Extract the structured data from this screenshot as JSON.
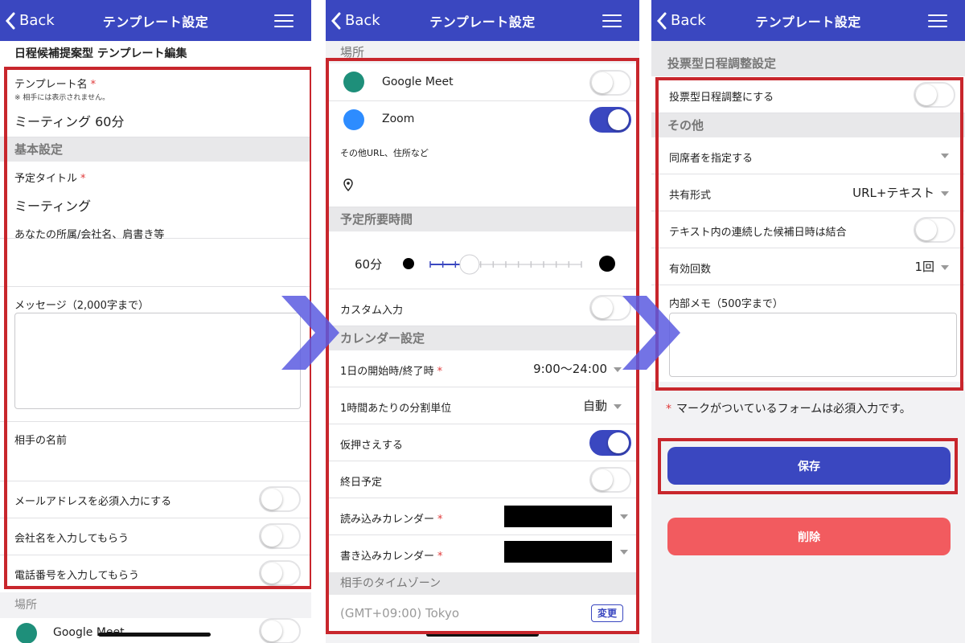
{
  "nav": {
    "back": "Back",
    "title": "テンプレート設定"
  },
  "p1": {
    "heading": "日程候補提案型 テンプレート編集",
    "template_name_label": "テンプレート名",
    "template_name_note": "※ 相手には表示されません。",
    "template_name_value": "ミーティング 60分",
    "section_basic": "基本設定",
    "title_label": "予定タイトル",
    "title_value": "ミーティング",
    "affiliation_label": "あなたの所属/会社名、肩書き等",
    "message_label": "メッセージ（2,000字まで）",
    "partner_name_label": "相手の名前",
    "email_required_label": "メールアドレスを必須入力にする",
    "company_label": "会社名を入力してもらう",
    "phone_label": "電話番号を入力してもらう",
    "section_place": "場所",
    "google_meet": "Google Meet"
  },
  "p2": {
    "section_place": "場所",
    "google_meet": "Google Meet",
    "zoom": "Zoom",
    "other_url_label": "その他URL、住所など",
    "section_duration": "予定所要時間",
    "duration_value": "60分",
    "custom_input_label": "カスタム入力",
    "section_calendar": "カレンダー設定",
    "start_end_label": "1日の開始時/終了時",
    "start_end_value": "9:00〜24:00",
    "split_unit_label": "1時間あたりの分割単位",
    "split_unit_value": "自動",
    "tentative_label": "仮押さえする",
    "allday_label": "終日予定",
    "read_cal_label": "読み込みカレンダー",
    "write_cal_label": "書き込みカレンダー",
    "section_timezone": "相手のタイムゾーン",
    "timezone_value": "(GMT+09:00) Tokyo",
    "change_button": "変更"
  },
  "p3": {
    "section_vote": "投票型日程調整設定",
    "vote_label": "投票型日程調整にする",
    "section_other": "その他",
    "attendee_label": "同席者を指定する",
    "share_format_label": "共有形式",
    "share_format_value": "URL+テキスト",
    "merge_label": "テキスト内の連続した候補日時は結合",
    "valid_count_label": "有効回数",
    "valid_count_value": "1回",
    "memo_label": "内部メモ（500字まで）",
    "required_note": "マークがついているフォームは必須入力です。",
    "save_button": "保存",
    "delete_button": "削除"
  },
  "toggles": {
    "p1_email_required": false,
    "p1_company": false,
    "p1_phone": false,
    "p1_google_meet": false,
    "p2_google_meet": false,
    "p2_zoom": true,
    "p2_custom_input": false,
    "p2_tentative": true,
    "p2_allday": false,
    "p3_vote": false,
    "p3_merge": false
  },
  "duration_slider_fraction": 0.26,
  "colors": {
    "nav": "#3a47c0",
    "highlight": "#c8262c",
    "save": "#3a47c0",
    "delete": "#f25b5f",
    "required": "#e03a3a"
  },
  "icons": {
    "back": "chevron-left-icon",
    "menu": "hamburger-menu-icon",
    "meet": "google-meet-icon",
    "zoom": "zoom-icon",
    "location": "location-pin-icon",
    "clock": "clock-icon"
  }
}
